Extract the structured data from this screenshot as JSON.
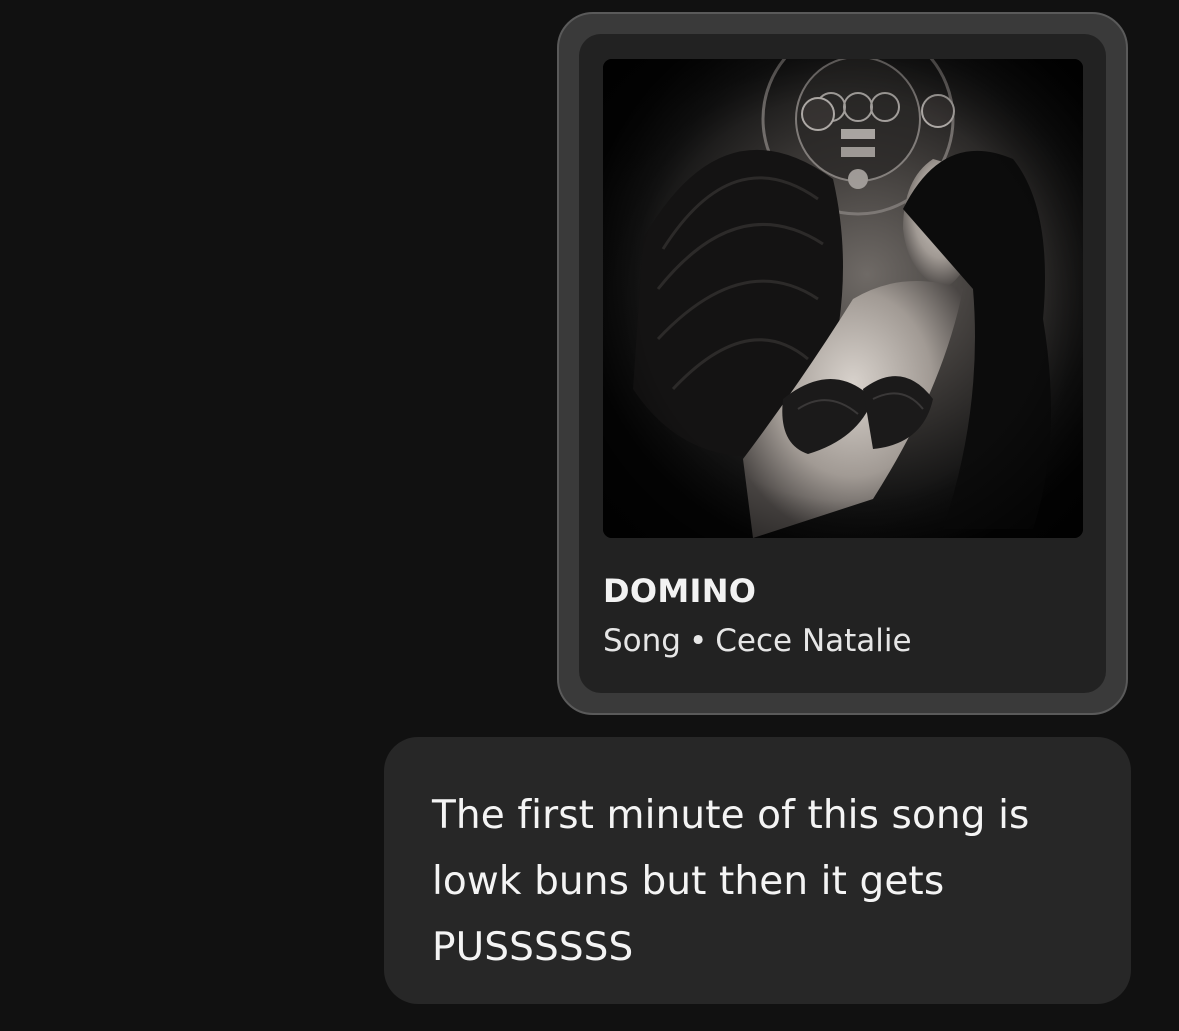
{
  "shared_song": {
    "title": "DOMINO",
    "type_label": "Song",
    "separator": "•",
    "artist": "Cece Natalie",
    "cover_art": "album-cover-image"
  },
  "message": {
    "lines": [
      "The first minute of this song is",
      "lowk buns but then it gets",
      "PUSSSSSS"
    ]
  },
  "colors": {
    "background": "#111111",
    "card_border": "#3a3a3a",
    "card_body": "#222222",
    "bubble": "#272727",
    "text": "#f2f2f2"
  }
}
